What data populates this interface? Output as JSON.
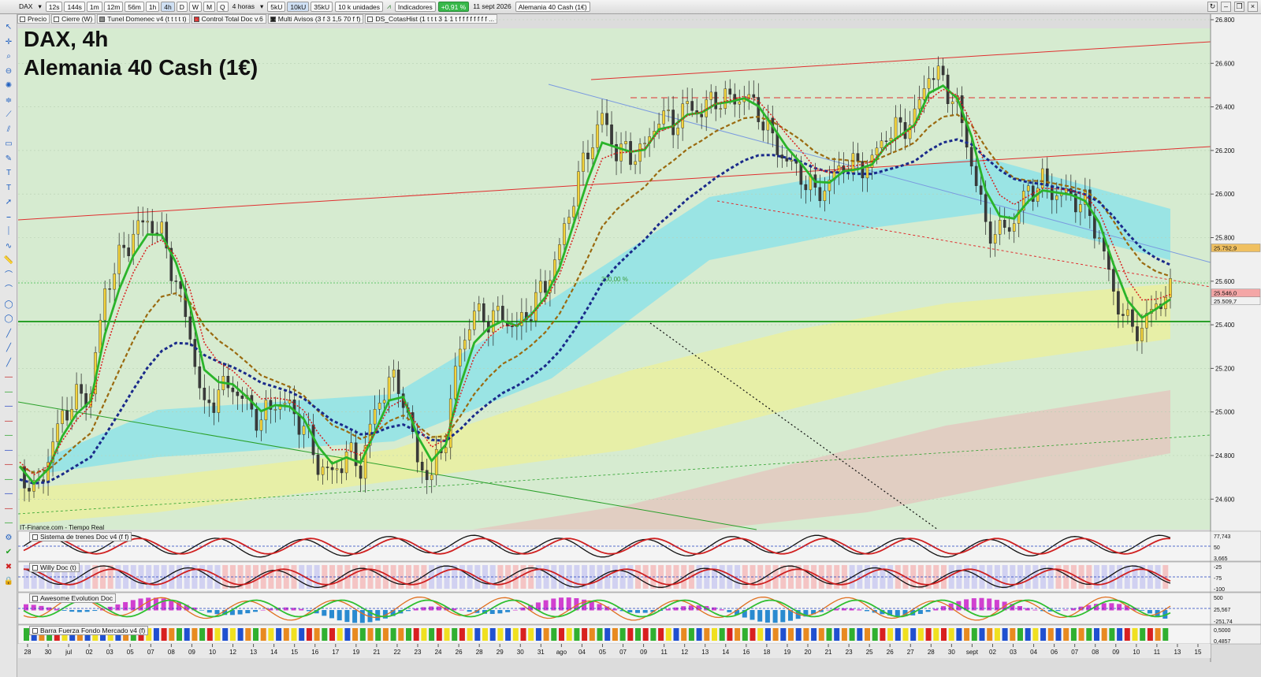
{
  "toolbar": {
    "symbol": "DAX",
    "timeframes": [
      "12s",
      "144s",
      "1m",
      "12m",
      "56m",
      "1h",
      "4h",
      "D",
      "W",
      "M",
      "Q"
    ],
    "period": "4 horas",
    "volumes": [
      "5kU",
      "10kU",
      "35kU"
    ],
    "units": "10 k unidades",
    "indicators": "Indicadores",
    "change": "+0,91 %",
    "date": "11 sept 2026",
    "instrument": "Alemania 40 Cash (1€)"
  },
  "indicator_tabs": [
    "Precio",
    "Cierre (W)",
    "Tunel Domenec v4 (t t t t t)",
    "Control Total Doc v.6",
    "Multi Avisos (3 f 3 1,5 70 f f)",
    "DS_CotasHist (1 t t t 3 1 1 t f f f f f f f f ..."
  ],
  "title": {
    "line1": "DAX, 4h",
    "line2": "Alemania 40 Cash (1€)"
  },
  "source": "IT-Finance.com - Tiempo Real",
  "annotation_pct": "300,00 %",
  "colors": {
    "background": "#d6ebd0",
    "up_candle": "#f2d23c",
    "down_candle": "#3a3a3a",
    "support": "#2aa02a",
    "channel": "#e03030",
    "ribbon_cyan": "#8fe3e8",
    "ribbon_yellow": "#eaf0a0",
    "ribbon_brown": "#e3c9c0"
  },
  "chart_data": [
    {
      "type": "candlestick",
      "title": "DAX, 4h",
      "subtitle": "Alemania 40 Cash (1€)",
      "y_ticks": [
        "26.800",
        "26.600",
        "26.400",
        "26.200",
        "26.000",
        "25.800",
        "25.600",
        "25.400",
        "25.200",
        "25.000",
        "24.800",
        "24.600"
      ],
      "ylim": [
        24500,
        26800
      ],
      "x_ticks": [
        "28",
        "30",
        "jul",
        "02",
        "03",
        "05",
        "07",
        "08",
        "09",
        "10",
        "12",
        "13",
        "14",
        "15",
        "16",
        "17",
        "19",
        "21",
        "22",
        "23",
        "24",
        "26",
        "28",
        "29",
        "30",
        "31",
        "ago",
        "04",
        "05",
        "07",
        "09",
        "11",
        "12",
        "13",
        "14",
        "16",
        "18",
        "19",
        "20",
        "21",
        "23",
        "25",
        "26",
        "27",
        "28",
        "30",
        "sept",
        "02",
        "03",
        "04",
        "06",
        "07",
        "08",
        "09",
        "10",
        "11",
        "13",
        "15"
      ],
      "price_flags": [
        {
          "label": "25.752,9",
          "value": 25752.9,
          "color": "#f0c060"
        },
        {
          "label": "25.546,0",
          "value": 25546.0,
          "color": "#f4a6a6"
        },
        {
          "label": "25.509,7",
          "value": 25509.7,
          "color": "#f0f0f0"
        }
      ],
      "close_path": [
        [
          0,
          24750
        ],
        [
          2,
          24620
        ],
        [
          4,
          24780
        ],
        [
          6,
          24990
        ],
        [
          8,
          25060
        ],
        [
          10,
          25090
        ],
        [
          12,
          25560
        ],
        [
          14,
          25700
        ],
        [
          16,
          25820
        ],
        [
          18,
          25880
        ],
        [
          20,
          25810
        ],
        [
          22,
          25600
        ],
        [
          24,
          25350
        ],
        [
          26,
          25000
        ],
        [
          28,
          25100
        ],
        [
          30,
          25120
        ],
        [
          32,
          25030
        ],
        [
          34,
          24960
        ],
        [
          36,
          25050
        ],
        [
          38,
          25020
        ],
        [
          40,
          24930
        ],
        [
          42,
          24760
        ],
        [
          44,
          24710
        ],
        [
          46,
          24810
        ],
        [
          48,
          24750
        ],
        [
          50,
          25000
        ],
        [
          52,
          25150
        ],
        [
          54,
          25080
        ],
        [
          56,
          24770
        ],
        [
          58,
          24700
        ],
        [
          60,
          24900
        ],
        [
          62,
          25300
        ],
        [
          64,
          25450
        ],
        [
          66,
          25430
        ],
        [
          68,
          25440
        ],
        [
          70,
          25380
        ],
        [
          72,
          25480
        ],
        [
          74,
          25580
        ],
        [
          76,
          25750
        ],
        [
          78,
          26000
        ],
        [
          80,
          26200
        ],
        [
          82,
          26350
        ],
        [
          84,
          26200
        ],
        [
          86,
          26180
        ],
        [
          88,
          26210
        ],
        [
          90,
          26360
        ],
        [
          92,
          26320
        ],
        [
          94,
          26400
        ],
        [
          96,
          26380
        ],
        [
          98,
          26440
        ],
        [
          100,
          26430
        ],
        [
          102,
          26450
        ],
        [
          104,
          26380
        ],
        [
          106,
          26250
        ],
        [
          108,
          26150
        ],
        [
          110,
          26090
        ],
        [
          112,
          26000
        ],
        [
          114,
          26050
        ],
        [
          116,
          26140
        ],
        [
          118,
          26120
        ],
        [
          120,
          26150
        ],
        [
          122,
          26280
        ],
        [
          124,
          26300
        ],
        [
          126,
          26350
        ],
        [
          128,
          26560
        ],
        [
          130,
          26520
        ],
        [
          132,
          26400
        ],
        [
          134,
          26150
        ],
        [
          136,
          25850
        ],
        [
          138,
          25820
        ],
        [
          140,
          25880
        ],
        [
          142,
          26020
        ],
        [
          144,
          26050
        ],
        [
          146,
          26000
        ],
        [
          148,
          25990
        ],
        [
          150,
          25950
        ],
        [
          152,
          25800
        ],
        [
          154,
          25550
        ],
        [
          156,
          25400
        ],
        [
          158,
          25380
        ],
        [
          160,
          25500
        ],
        [
          162,
          25546
        ]
      ]
    },
    {
      "type": "line",
      "title": "Sistema de trenes Doc v4 (f f)",
      "y_ticks": [
        "77,743",
        "50",
        "3,665"
      ]
    },
    {
      "type": "line",
      "title": "Willy Doc (t)",
      "y_ticks": [
        "-25",
        "-75",
        "-100"
      ]
    },
    {
      "type": "bar",
      "title": "Awesome Evolution Doc",
      "y_ticks": [
        "500",
        "25,567",
        "-251,74"
      ]
    },
    {
      "type": "bar",
      "title": "Barra Fuerza Fondo Mercado v4 (f)",
      "y_ticks": [
        "0,5000",
        "0,4857"
      ]
    }
  ]
}
